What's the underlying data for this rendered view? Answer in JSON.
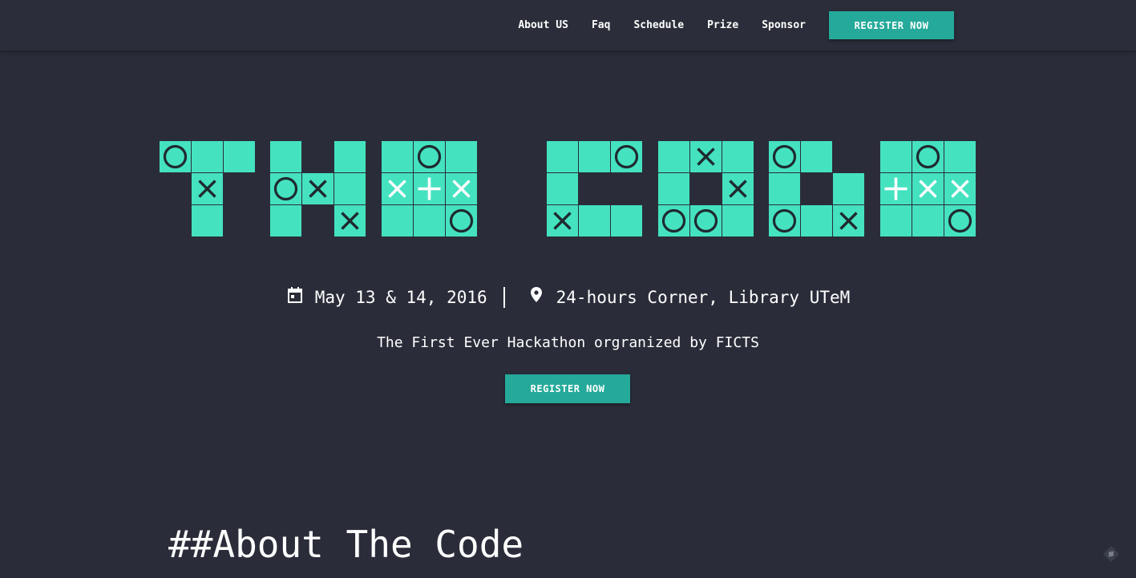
{
  "nav": {
    "links": [
      "About US",
      "Faq",
      "Schedule",
      "Prize",
      "Sponsor"
    ],
    "register_label": "REGISTER NOW"
  },
  "logo": {
    "text": "THE CODE",
    "cell_color": "#45e2c0",
    "mark_dark": "#1f2a30",
    "mark_light": "#ffffff"
  },
  "hero": {
    "date": "May 13 & 14, 2016",
    "location": "24-hours Corner, Library UTeM",
    "tagline": "The First Ever Hackathon orgranized by FICTS",
    "register_label": "REGISTER NOW"
  },
  "about": {
    "title": "##About The Code"
  },
  "icons": {
    "date": "calendar-icon",
    "location": "map-pin-icon",
    "corner": "feather-icon"
  },
  "colors": {
    "background": "#2a2d39",
    "accent": "#25a99a",
    "text": "#ffffff"
  }
}
